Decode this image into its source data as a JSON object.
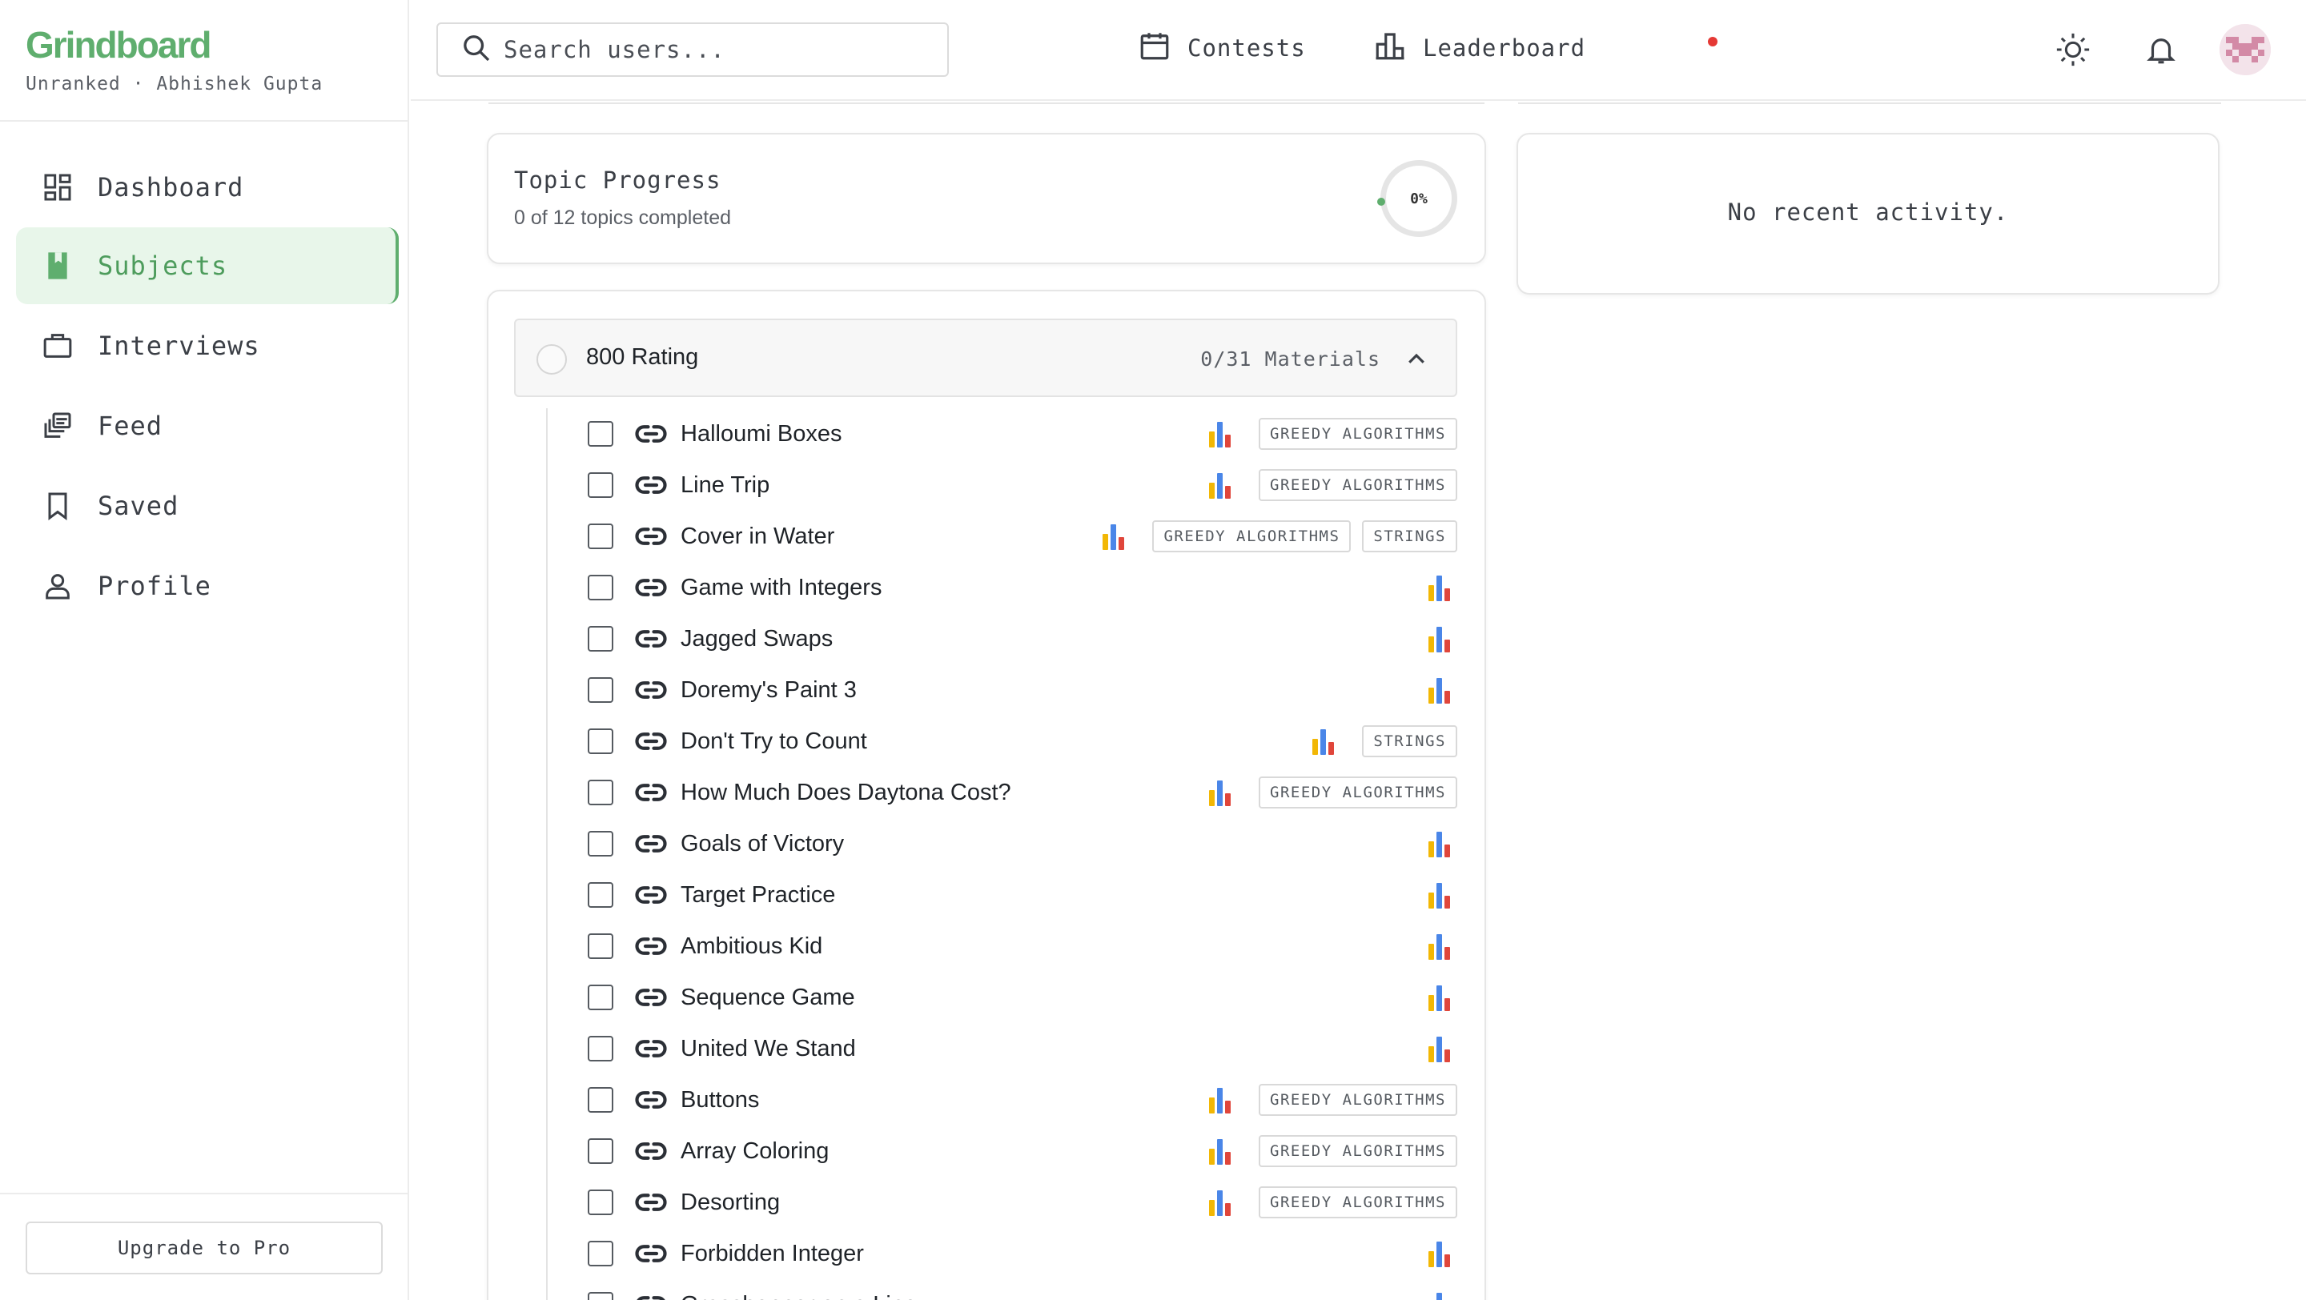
{
  "brand": {
    "name": "Grindboard",
    "subtitle": "Unranked · Abhishek Gupta"
  },
  "sidebar": {
    "items": [
      {
        "label": "Dashboard",
        "icon": "dashboard-icon",
        "active": false
      },
      {
        "label": "Subjects",
        "icon": "book-icon",
        "active": true
      },
      {
        "label": "Interviews",
        "icon": "briefcase-icon",
        "active": false
      },
      {
        "label": "Feed",
        "icon": "feed-icon",
        "active": false
      },
      {
        "label": "Saved",
        "icon": "bookmark-icon",
        "active": false
      },
      {
        "label": "Profile",
        "icon": "user-icon",
        "active": false
      }
    ],
    "upgrade_label": "Upgrade to Pro"
  },
  "header": {
    "search_placeholder": "Search users...",
    "contests_label": "Contests",
    "contests_has_notification": true,
    "leaderboard_label": "Leaderboard",
    "icons": [
      "sun-icon",
      "bell-icon",
      "avatar"
    ]
  },
  "topic_progress": {
    "title": "Topic Progress",
    "subtitle": "0 of 12 topics completed",
    "percent_label": "0%",
    "percent": 0
  },
  "recent_activity": {
    "empty_text": "No recent activity."
  },
  "section": {
    "title": "800 Rating",
    "materials": "0/31 Materials",
    "expanded": true
  },
  "problems": [
    {
      "name": "Halloumi Boxes",
      "tags": [
        "GREEDY ALGORITHMS"
      ],
      "checked": false
    },
    {
      "name": "Line Trip",
      "tags": [
        "GREEDY ALGORITHMS"
      ],
      "checked": false
    },
    {
      "name": "Cover in Water",
      "tags": [
        "GREEDY ALGORITHMS",
        "STRINGS"
      ],
      "checked": false
    },
    {
      "name": "Game with Integers",
      "tags": [],
      "checked": false
    },
    {
      "name": "Jagged Swaps",
      "tags": [],
      "checked": false
    },
    {
      "name": "Doremy's Paint 3",
      "tags": [],
      "checked": false
    },
    {
      "name": "Don't Try to Count",
      "tags": [
        "STRINGS"
      ],
      "checked": false
    },
    {
      "name": "How Much Does Daytona Cost?",
      "tags": [
        "GREEDY ALGORITHMS"
      ],
      "checked": false
    },
    {
      "name": "Goals of Victory",
      "tags": [],
      "checked": false
    },
    {
      "name": "Target Practice",
      "tags": [],
      "checked": false
    },
    {
      "name": "Ambitious Kid",
      "tags": [],
      "checked": false
    },
    {
      "name": "Sequence Game",
      "tags": [],
      "checked": false
    },
    {
      "name": "United We Stand",
      "tags": [],
      "checked": false
    },
    {
      "name": "Buttons",
      "tags": [
        "GREEDY ALGORITHMS"
      ],
      "checked": false
    },
    {
      "name": "Array Coloring",
      "tags": [
        "GREEDY ALGORITHMS"
      ],
      "checked": false
    },
    {
      "name": "Desorting",
      "tags": [
        "GREEDY ALGORITHMS"
      ],
      "checked": false
    },
    {
      "name": "Forbidden Integer",
      "tags": [],
      "checked": false
    },
    {
      "name": "Grasshopper on a Line",
      "tags": [],
      "checked": false
    }
  ],
  "colors": {
    "brand_green": "#5fae6e",
    "active_bg": "#e8f6ea",
    "bar_yellow": "#f2b705",
    "bar_blue": "#4a86e8",
    "bar_red": "#e0463b",
    "notification_red": "#e53935"
  }
}
